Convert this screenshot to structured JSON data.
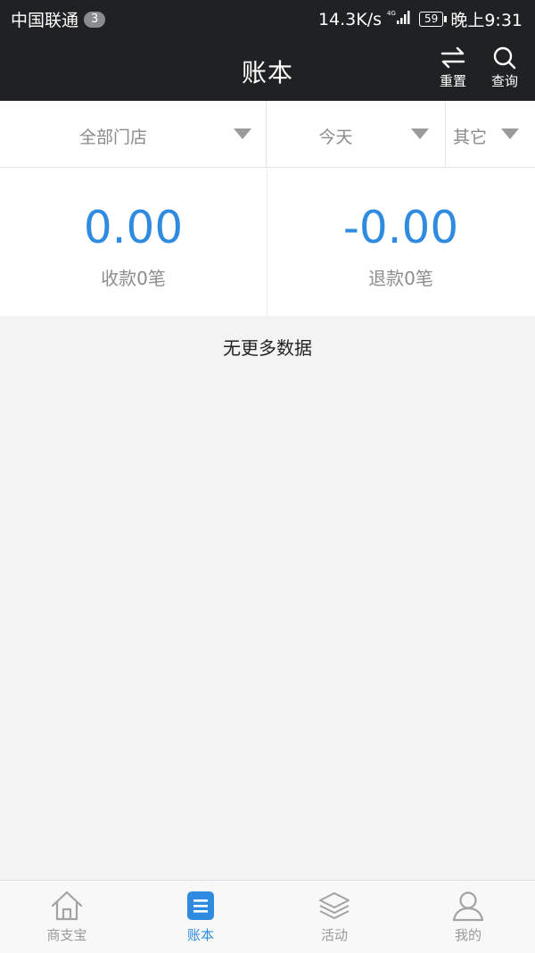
{
  "status_bar": {
    "carrier": "中国联通",
    "badge": "3",
    "speed": "14.3K/s",
    "network": "4G",
    "battery": "59",
    "time": "晚上9:31"
  },
  "header": {
    "title": "账本",
    "actions": {
      "reset": "重置",
      "query": "查询"
    }
  },
  "filters": {
    "store": "全部门店",
    "date": "今天",
    "other": "其它"
  },
  "stats": {
    "income": {
      "amount": "0.00",
      "count": "收款0笔"
    },
    "refund": {
      "amount": "-0.00",
      "count": "退款0笔"
    }
  },
  "list": {
    "empty_text": "无更多数据"
  },
  "tabs": [
    {
      "label": "商支宝",
      "icon": "home-icon"
    },
    {
      "label": "账本",
      "icon": "ledger-icon",
      "active": true
    },
    {
      "label": "活动",
      "icon": "layers-icon"
    },
    {
      "label": "我的",
      "icon": "user-icon"
    }
  ],
  "colors": {
    "accent": "#2f8be0",
    "header_bg": "#1f2123",
    "page_bg": "#f3f3f3",
    "inactive": "#9a9a9a"
  }
}
